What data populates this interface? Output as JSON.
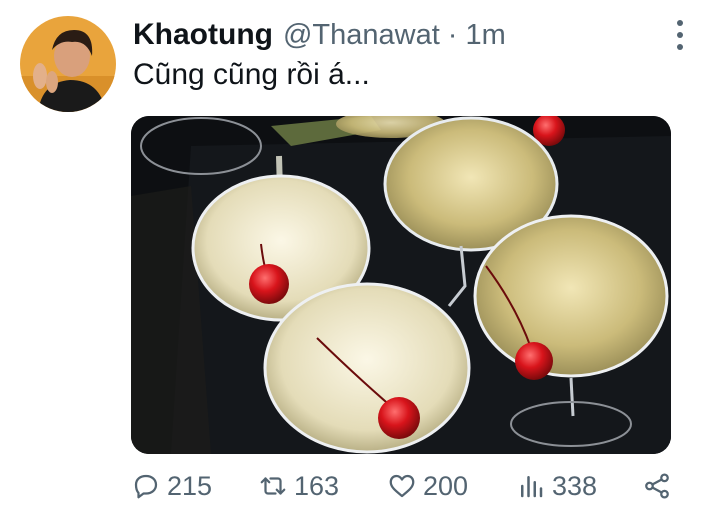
{
  "tweet": {
    "display_name": "Khaotung",
    "handle": "@Thanawat",
    "separator": "·",
    "time": "1m",
    "text": "Cũng cũng rồi á..."
  },
  "actions": {
    "replies": "215",
    "retweets": "163",
    "likes": "200",
    "views": "338"
  },
  "icons": [
    "reply-icon",
    "retweet-icon",
    "like-icon",
    "views-icon",
    "share-icon",
    "more-options-icon"
  ],
  "colors": {
    "text_primary": "#0f1419",
    "text_secondary": "#536471"
  }
}
